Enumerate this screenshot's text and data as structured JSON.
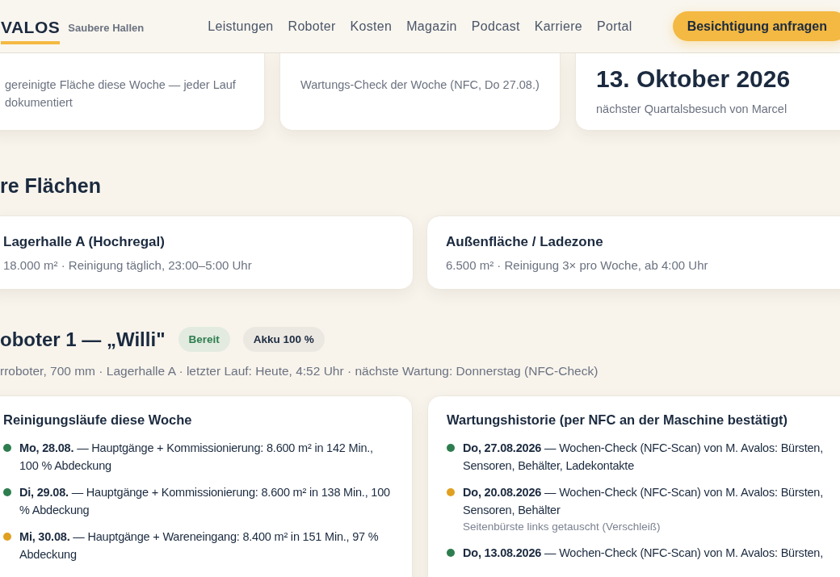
{
  "header": {
    "logo": "VALOS",
    "tagline": "Saubere Hallen",
    "nav": [
      "Leistungen",
      "Roboter",
      "Kosten",
      "Magazin",
      "Podcast",
      "Karriere",
      "Portal"
    ],
    "cta": "Besichtigung anfragen"
  },
  "stats": [
    {
      "description": "gereinigte Fläche diese Woche — jeder Lauf dokumentiert"
    },
    {
      "description": "Wartungs-Check der Woche (NFC, Do 27.08.)"
    },
    {
      "value": "13. Oktober 2026",
      "description": "nächster Quartalsbesuch von Marcel"
    }
  ],
  "areas_heading": "re Flächen",
  "areas": [
    {
      "name": "Lagerhalle A (Hochregal)",
      "details": "18.000 m² · Reinigung täglich, 23:00–5:00 Uhr"
    },
    {
      "name": "Außenfläche / Ladezone",
      "details": "6.500 m² · Reinigung 3× pro Woche, ab 4:00 Uhr"
    }
  ],
  "robot": {
    "title": "oboter 1 — „Willi\"",
    "badges": [
      {
        "label": "Bereit",
        "kind": "status"
      },
      {
        "label": "Akku 100 %",
        "kind": "info"
      }
    ],
    "meta": "rroboter, 700 mm · Lagerhalle A · letzter Lauf: Heute, 4:52 Uhr · nächste Wartung: Donnerstag (NFC-Check)"
  },
  "runs": {
    "title": "Reinigungsläufe diese Woche",
    "items": [
      {
        "text": "**Mo, 28.08.** — Hauptgänge + Kommissionierung: 8.600 m² in 142 Min., 100 % Abdeckung",
        "color": "#2e7d4f"
      },
      {
        "text": "**Di, 29.08.** — Hauptgänge + Kommissionierung: 8.600 m² in 138 Min., 100 % Abdeckung",
        "color": "#2e7d4f"
      },
      {
        "text": "**Mi, 30.08.** — Hauptgänge + Wareneingang: 8.400 m² in 151 Min., 97 % Abdeckung",
        "color": "#e0a020"
      }
    ]
  },
  "maintenance": {
    "title": "Wartungshistorie (per NFC an der Maschine bestätigt)",
    "items": [
      {
        "text": "**Do, 27.08.2026** — Wochen-Check (NFC-Scan) von M. Avalos: Bürsten, Sensoren, Behälter, Ladekontakte",
        "color": "#2e7d4f"
      },
      {
        "text": "**Do, 20.08.2026** — Wochen-Check (NFC-Scan) von M. Avalos: Bürsten, Sensoren, Behälter",
        "color": "#e0a020",
        "note": "Seitenbürste links getauscht (Verschleiß)"
      },
      {
        "text": "**Do, 13.08.2026** — Wochen-Check (NFC-Scan) von M. Avalos: Bürsten,",
        "color": "#2e7d4f"
      }
    ]
  }
}
